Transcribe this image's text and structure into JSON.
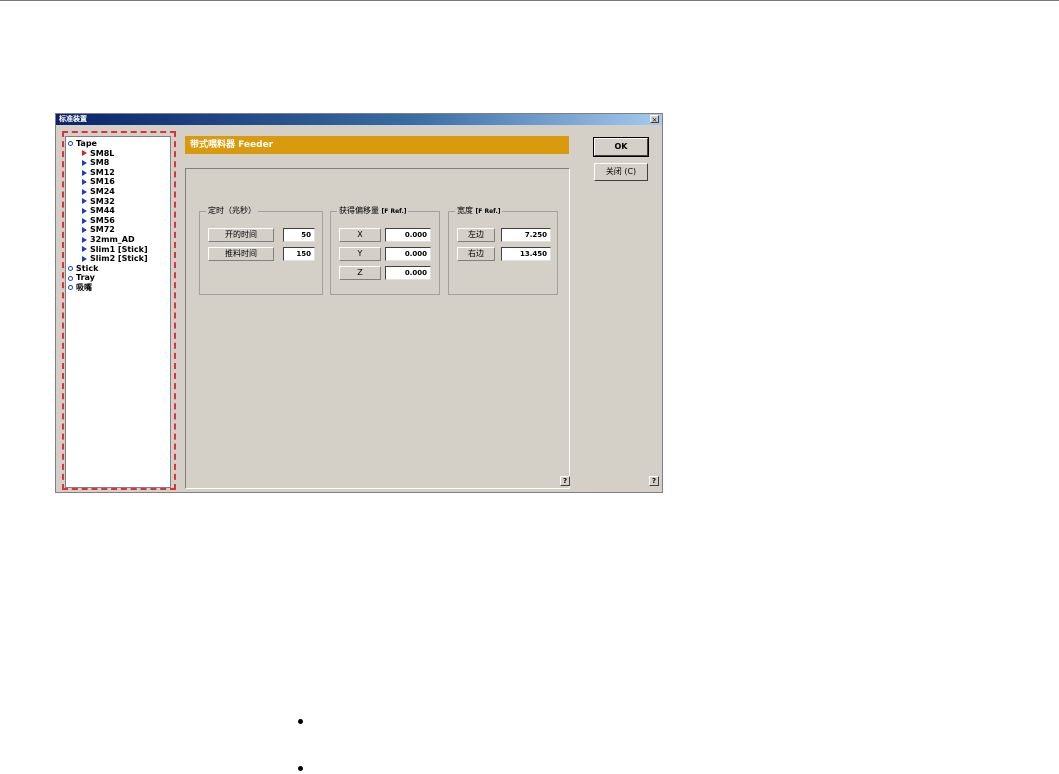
{
  "window": {
    "title": "标准装置",
    "close_glyph": "×"
  },
  "tree": {
    "items": [
      {
        "label": "Tape",
        "level": 0
      },
      {
        "label": "SM8L",
        "level": 1,
        "active": true
      },
      {
        "label": "SM8",
        "level": 1
      },
      {
        "label": "SM12",
        "level": 1
      },
      {
        "label": "SM16",
        "level": 1
      },
      {
        "label": "SM24",
        "level": 1
      },
      {
        "label": "SM32",
        "level": 1
      },
      {
        "label": "SM44",
        "level": 1
      },
      {
        "label": "SM56",
        "level": 1
      },
      {
        "label": "SM72",
        "level": 1
      },
      {
        "label": "32mm_AD",
        "level": 1
      },
      {
        "label": "Slim1 [Stick]",
        "level": 1
      },
      {
        "label": "Slim2 [Stick]",
        "level": 1
      },
      {
        "label": "Stick",
        "level": 0
      },
      {
        "label": "Tray",
        "level": 0
      },
      {
        "label": "吸嘴",
        "level": 0
      }
    ]
  },
  "header": {
    "title": "带式喂料器 Feeder"
  },
  "timing": {
    "title": "定时（兆秒）",
    "open_label": "开的时间",
    "open_value": "50",
    "push_label": "推料时间",
    "push_value": "150"
  },
  "offset": {
    "title": "获得偏移量",
    "title_ref": "[F Ref.]",
    "x_label": "X",
    "x_value": "0.000",
    "y_label": "Y",
    "y_value": "0.000",
    "z_label": "Z",
    "z_value": "0.000"
  },
  "width": {
    "title": "宽度",
    "title_ref": "[F Ref.]",
    "left_label": "左边",
    "left_value": "7.250",
    "right_label": "右边",
    "right_value": "13.450"
  },
  "buttons": {
    "ok_label": "OK",
    "close_label": "关闭 (C)",
    "help_glyph": "?"
  },
  "colors": {
    "header": "#d99b0d",
    "dialog": "#d4d0c8",
    "annotation": "#e0303a",
    "titlebar": "#0a246a"
  }
}
